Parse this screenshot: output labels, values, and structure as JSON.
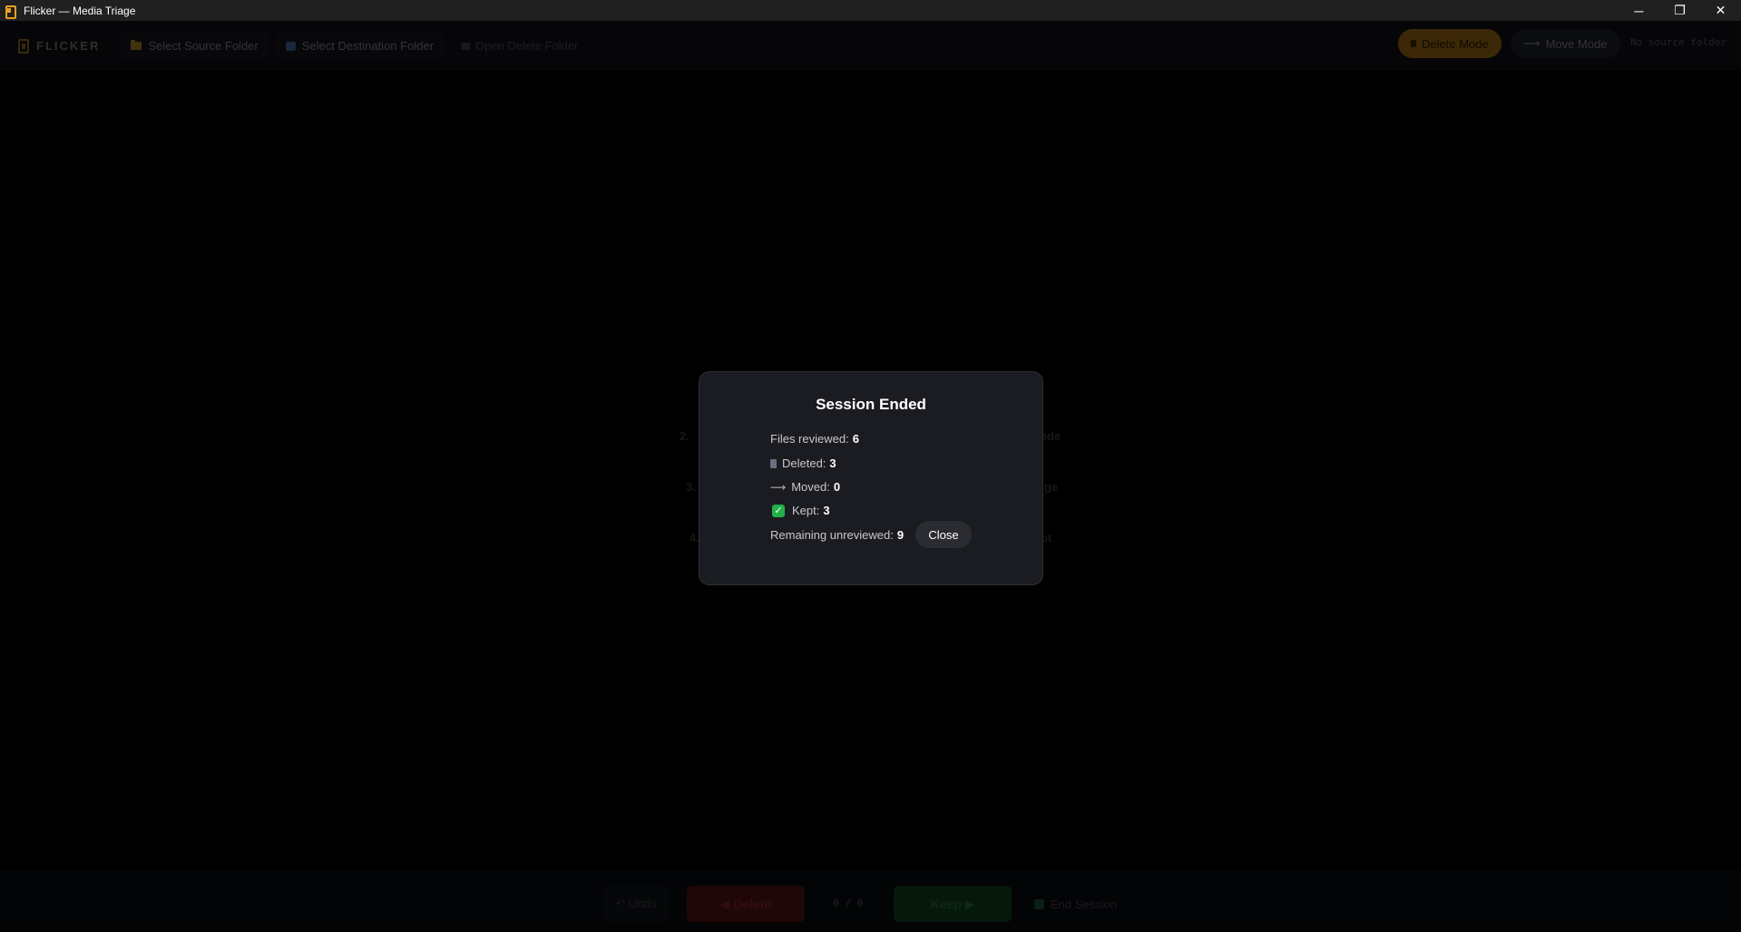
{
  "window": {
    "title": "Flicker — Media Triage",
    "controls": {
      "minimize": "─",
      "restore": "❐",
      "close": "✕"
    }
  },
  "toolbar": {
    "logo_text": "FLICKER",
    "select_source_label": "Select Source Folder",
    "select_destination_label": "Select Destination Folder",
    "open_delete_label": "Open Delete Folder",
    "delete_mode_label": "Delete Mode",
    "move_mode_label": "Move Mode",
    "move_mode_arrow": "⟶",
    "source_status": "No source folder"
  },
  "stage": {
    "hints": {
      "step2_prefix": "2.",
      "step2_suffix": "ode",
      "step3_prefix": "3.",
      "step3_suffix": "ge",
      "step4_prefix": "4.",
      "step4_suffix": "pt"
    }
  },
  "bottom": {
    "undo_label": "↶ Undo",
    "delete_label": "◀ Delete",
    "counter": "0 / 0",
    "keep_label": "Keep ▶",
    "end_session_label": "End Session"
  },
  "modal": {
    "title": "Session Ended",
    "files_reviewed_label": "Files reviewed:",
    "files_reviewed_value": "6",
    "deleted_label": "Deleted:",
    "deleted_value": "3",
    "moved_arrow": "⟶",
    "moved_label": "Moved:",
    "moved_value": "0",
    "kept_check": "✓",
    "kept_label": "Kept:",
    "kept_value": "3",
    "remaining_label": "Remaining unreviewed:",
    "remaining_value": "9",
    "close_label": "Close"
  },
  "colors": {
    "accent_delete_mode": "#6e4a0c",
    "kept_check": "#22b04a",
    "modal_bg": "#1b1c21"
  }
}
